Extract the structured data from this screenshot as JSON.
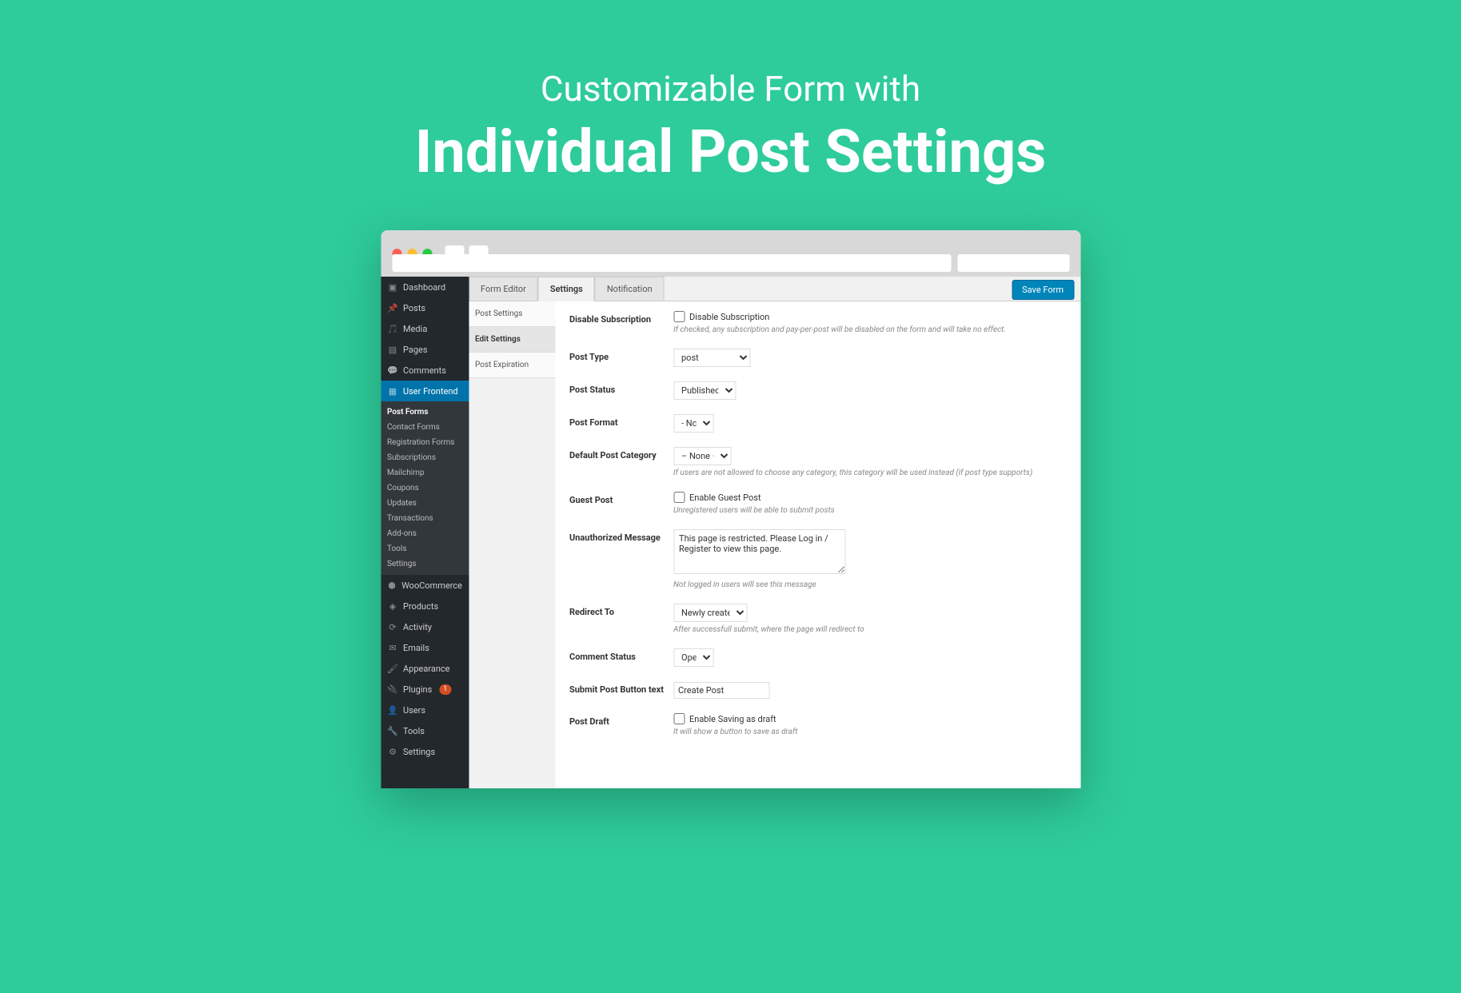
{
  "hero": {
    "subtitle": "Customizable Form with",
    "title": "Individual Post Settings"
  },
  "wp_menu": {
    "dashboard": "Dashboard",
    "posts": "Posts",
    "media": "Media",
    "pages": "Pages",
    "comments": "Comments",
    "user_frontend": "User Frontend",
    "woocommerce": "WooCommerce",
    "products": "Products",
    "activity": "Activity",
    "emails": "Emails",
    "appearance": "Appearance",
    "plugins": "Plugins",
    "plugins_badge": "1",
    "users": "Users",
    "tools": "Tools",
    "settings": "Settings"
  },
  "wp_submenu": {
    "post_forms": "Post Forms",
    "contact_forms": "Contact Forms",
    "registration_forms": "Registration Forms",
    "subscriptions": "Subscriptions",
    "mailchimp": "Mailchimp",
    "coupons": "Coupons",
    "updates": "Updates",
    "transactions": "Transactions",
    "addons": "Add-ons",
    "tools": "Tools",
    "settings": "Settings"
  },
  "tabs": {
    "form_editor": "Form Editor",
    "settings": "Settings",
    "notification": "Notification"
  },
  "save_button": "Save Form",
  "settings_nav": {
    "post_settings": "Post Settings",
    "edit_settings": "Edit Settings",
    "post_expiration": "Post Expiration"
  },
  "form": {
    "disable_subscription": {
      "label": "Disable Subscription",
      "checkbox": "Disable Subscription",
      "help": "If checked, any subscription and pay-per-post will be disabled on the form and will take no effect."
    },
    "post_type": {
      "label": "Post Type",
      "value": "post"
    },
    "post_status": {
      "label": "Post Status",
      "value": "Published"
    },
    "post_format": {
      "label": "Post Format",
      "value": "- None -"
    },
    "default_category": {
      "label": "Default Post Category",
      "value": "– None –",
      "help": "If users are not allowed to choose any category, this category will be used instead (if post type supports)"
    },
    "guest_post": {
      "label": "Guest Post",
      "checkbox": "Enable Guest Post",
      "help": "Unregistered users will be able to submit posts"
    },
    "unauthorized_message": {
      "label": "Unauthorized Message",
      "value": "This page is restricted. Please Log in / Register to view this page.",
      "help": "Not logged in users will see this message"
    },
    "redirect_to": {
      "label": "Redirect To",
      "value": "Newly created post",
      "help": "After successfull submit, where the page will redirect to"
    },
    "comment_status": {
      "label": "Comment Status",
      "value": "Open"
    },
    "submit_button_text": {
      "label": "Submit Post Button text",
      "value": "Create Post"
    },
    "post_draft": {
      "label": "Post Draft",
      "checkbox": "Enable Saving as draft",
      "help": "It will show a button to save as draft"
    }
  }
}
